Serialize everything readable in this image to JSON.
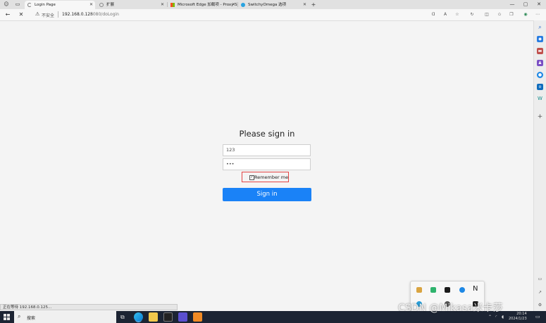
{
  "browser": {
    "tabs": [
      {
        "title": "Login Page",
        "active": true
      },
      {
        "title": "扩展",
        "active": false
      },
      {
        "title": "Microsoft Edge 加载项 - Proxy S",
        "active": false
      },
      {
        "title": "SwitchyOmega 选项",
        "active": false
      }
    ],
    "new_tab_symbol": "+",
    "security_label": "不安全",
    "url_host": "192.168.0.125",
    "url_path": ":8080/doLogin"
  },
  "page": {
    "heading": "Please sign in",
    "username_value": "123",
    "password_value": "•••",
    "remember_label": "Remember me",
    "remember_checked": true,
    "signin_label": "Sign in"
  },
  "status_bar": {
    "text": "正在等待 192.168.0.125..."
  },
  "taskbar": {
    "search_placeholder": "搜索",
    "time": "20:14",
    "date": "2024/1/23"
  },
  "watermark": "CSDN @Mikasa米卡莎",
  "colors": {
    "signin_button": "#1a82f7",
    "highlight_box": "#e24444",
    "taskbar": "#1c2433"
  },
  "icons": {
    "sidebar": [
      "search-icon",
      "shopping-tag-icon",
      "toolbox-icon",
      "people-icon",
      "office-icon",
      "outlook-icon",
      "bing-w-icon",
      "add-icon"
    ]
  }
}
